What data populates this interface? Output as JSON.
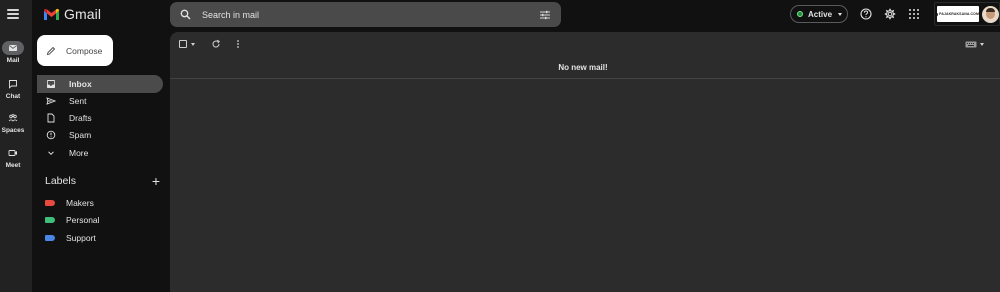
{
  "app": {
    "name": "Gmail"
  },
  "rail": {
    "items": [
      {
        "label": "Mail",
        "icon": "mail-icon",
        "active": true
      },
      {
        "label": "Chat",
        "icon": "chat-icon",
        "active": false
      },
      {
        "label": "Spaces",
        "icon": "spaces-icon",
        "active": false
      },
      {
        "label": "Meet",
        "icon": "meet-icon",
        "active": false
      }
    ]
  },
  "search": {
    "placeholder": "Search in mail"
  },
  "status": {
    "label": "Active",
    "color": "#1e8e3e"
  },
  "account": {
    "brand_text": "PAJAKRAKSANA.COM"
  },
  "compose": {
    "label": "Compose"
  },
  "nav": [
    {
      "label": "Inbox",
      "icon": "inbox-icon",
      "active": true
    },
    {
      "label": "Sent",
      "icon": "send-icon",
      "active": false
    },
    {
      "label": "Drafts",
      "icon": "draft-icon",
      "active": false
    },
    {
      "label": "Spam",
      "icon": "spam-icon",
      "active": false
    },
    {
      "label": "More",
      "icon": "chevron-down-icon",
      "active": false
    }
  ],
  "labels": {
    "heading": "Labels",
    "items": [
      {
        "name": "Makers",
        "color": "#e84a3f"
      },
      {
        "name": "Personal",
        "color": "#3fbf7a"
      },
      {
        "name": "Support",
        "color": "#4a86e8"
      }
    ]
  },
  "main": {
    "empty_message": "No new mail!"
  }
}
